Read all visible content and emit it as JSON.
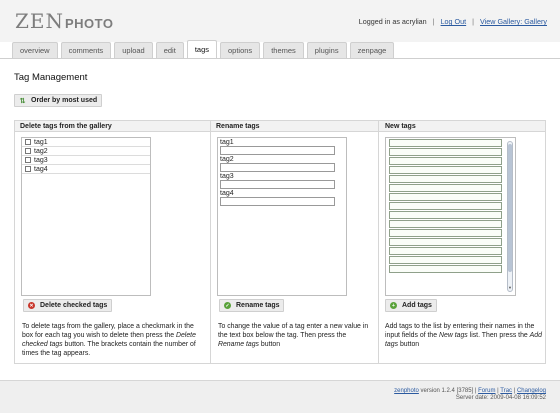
{
  "brand": {
    "zen": "ZEN",
    "photo": "PHOTO"
  },
  "user": {
    "status": "Logged in as acrylian",
    "logout": "Log Out",
    "separator": "|",
    "view_gallery": "View Gallery: Gallery"
  },
  "tabs": [
    {
      "label": "overview",
      "active": false
    },
    {
      "label": "comments",
      "active": false
    },
    {
      "label": "upload",
      "active": false
    },
    {
      "label": "edit",
      "active": false
    },
    {
      "label": "tags",
      "active": true
    },
    {
      "label": "options",
      "active": false
    },
    {
      "label": "themes",
      "active": false
    },
    {
      "label": "plugins",
      "active": false
    },
    {
      "label": "zenpage",
      "active": false
    }
  ],
  "page": {
    "title": "Tag Management",
    "order_button": "Order by most used"
  },
  "delete_panel": {
    "header": "Delete tags from the gallery",
    "tags": [
      "tag1",
      "tag2",
      "tag3",
      "tag4"
    ],
    "button": "Delete checked tags",
    "desc_1": "To delete tags from the gallery, place a checkmark in the box for each tag you wish to delete then press the ",
    "desc_em": "Delete checked tags",
    "desc_2": " button. The brackets contain the number of times the tag appears."
  },
  "rename_panel": {
    "header": "Rename tags",
    "tags": [
      "tag1",
      "tag2",
      "tag3",
      "tag4"
    ],
    "button": "Rename tags",
    "desc_1": "To change the value of a tag enter a new value in the text box below the tag. Then press the ",
    "desc_em": "Rename tags",
    "desc_2": " button"
  },
  "new_panel": {
    "header": "New tags",
    "button": "Add tags",
    "desc_1": "Add tags to the list by entering their names in the input fields of the ",
    "desc_em1": "New tags",
    "desc_2": " list. Then press the ",
    "desc_em2": "Add tags",
    "desc_3": " button"
  },
  "footer": {
    "brand": "zenphoto",
    "version": " version 1.2.4 [3785] | ",
    "forum": "Forum",
    "sep": " | ",
    "trac": "Trac",
    "changelog": "Changelog",
    "server_date": "Server date: 2009-04-08 16:09:52"
  },
  "colors": {
    "link": "#2b5aa0",
    "delete_icon": "#c8362b",
    "ok_icon": "#59a23a",
    "sort_icon": "#4a8f3a"
  }
}
